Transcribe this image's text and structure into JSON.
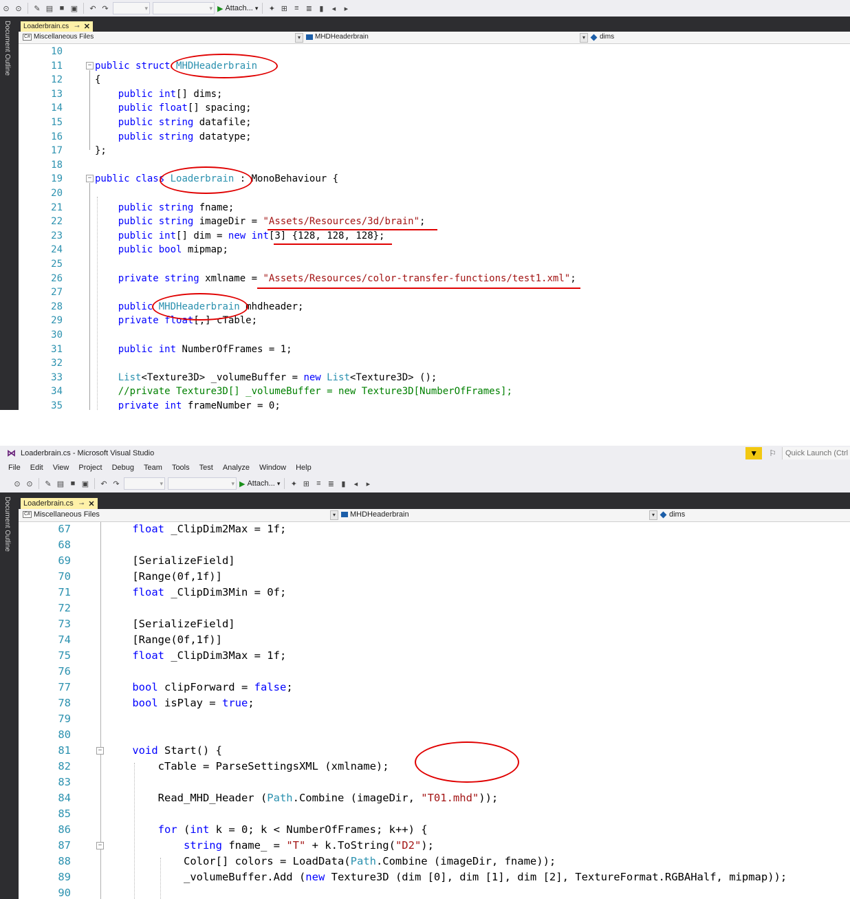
{
  "app_title": "Loaderbrain.cs - Microsoft Visual Studio",
  "quick_launch": "Quick Launch (Ctrl",
  "menu": [
    "File",
    "Edit",
    "View",
    "Project",
    "Debug",
    "Team",
    "Tools",
    "Test",
    "Analyze",
    "Window",
    "Help"
  ],
  "toolbar": {
    "attach_label": "Attach..."
  },
  "side_panel_label": "Document Outline",
  "tab": {
    "label": "Loaderbrain.cs",
    "pin": "⊸",
    "close": "✕"
  },
  "nav": {
    "project": "Miscellaneous Files",
    "type": "MHDHeaderbrain",
    "member": "dims"
  },
  "annotation_color": "#e00000",
  "colors": {
    "keyword": "#0000ff",
    "type": "#2b91af",
    "string": "#a31515",
    "comment": "#008000",
    "line_number": "#2b91af"
  },
  "shot1_lines": [
    {
      "n": "10",
      "tokens": []
    },
    {
      "n": "11",
      "tokens": [
        {
          "t": "public ",
          "c": "kw"
        },
        {
          "t": "struct ",
          "c": "kw"
        },
        {
          "t": "MHDHeaderbrain",
          "c": "ty"
        }
      ]
    },
    {
      "n": "12",
      "tokens": [
        {
          "t": "{"
        }
      ]
    },
    {
      "n": "13",
      "tokens": [
        {
          "t": "    "
        },
        {
          "t": "public ",
          "c": "kw"
        },
        {
          "t": "int",
          "c": "kw"
        },
        {
          "t": "[] dims;"
        }
      ]
    },
    {
      "n": "14",
      "tokens": [
        {
          "t": "    "
        },
        {
          "t": "public ",
          "c": "kw"
        },
        {
          "t": "float",
          "c": "kw"
        },
        {
          "t": "[] spacing;"
        }
      ]
    },
    {
      "n": "15",
      "tokens": [
        {
          "t": "    "
        },
        {
          "t": "public ",
          "c": "kw"
        },
        {
          "t": "string",
          "c": "kw"
        },
        {
          "t": " datafile;"
        }
      ]
    },
    {
      "n": "16",
      "tokens": [
        {
          "t": "    "
        },
        {
          "t": "public ",
          "c": "kw"
        },
        {
          "t": "string",
          "c": "kw"
        },
        {
          "t": " datatype;"
        }
      ]
    },
    {
      "n": "17",
      "tokens": [
        {
          "t": "};"
        }
      ]
    },
    {
      "n": "18",
      "tokens": []
    },
    {
      "n": "19",
      "tokens": [
        {
          "t": "public ",
          "c": "kw"
        },
        {
          "t": "class ",
          "c": "kw"
        },
        {
          "t": "Loaderbrain",
          "c": "ty"
        },
        {
          "t": " : MonoBehaviour {"
        }
      ]
    },
    {
      "n": "20",
      "tokens": []
    },
    {
      "n": "21",
      "tokens": [
        {
          "t": "    "
        },
        {
          "t": "public ",
          "c": "kw"
        },
        {
          "t": "string",
          "c": "kw"
        },
        {
          "t": " fname;"
        }
      ]
    },
    {
      "n": "22",
      "tokens": [
        {
          "t": "    "
        },
        {
          "t": "public ",
          "c": "kw"
        },
        {
          "t": "string",
          "c": "kw"
        },
        {
          "t": " imageDir = "
        },
        {
          "t": "\"Assets/Resources/3d/brain\"",
          "c": "str"
        },
        {
          "t": ";"
        }
      ]
    },
    {
      "n": "23",
      "tokens": [
        {
          "t": "    "
        },
        {
          "t": "public ",
          "c": "kw"
        },
        {
          "t": "int",
          "c": "kw"
        },
        {
          "t": "[] dim = "
        },
        {
          "t": "new ",
          "c": "kw"
        },
        {
          "t": "int",
          "c": "kw"
        },
        {
          "t": "[3] {128, 128, 128};"
        }
      ]
    },
    {
      "n": "24",
      "tokens": [
        {
          "t": "    "
        },
        {
          "t": "public ",
          "c": "kw"
        },
        {
          "t": "bool",
          "c": "kw"
        },
        {
          "t": " mipmap;"
        }
      ]
    },
    {
      "n": "25",
      "tokens": []
    },
    {
      "n": "26",
      "tokens": [
        {
          "t": "    "
        },
        {
          "t": "private ",
          "c": "kw"
        },
        {
          "t": "string",
          "c": "kw"
        },
        {
          "t": " xmlname = "
        },
        {
          "t": "\"Assets/Resources/color-transfer-functions/test1.xml\"",
          "c": "str"
        },
        {
          "t": ";"
        }
      ]
    },
    {
      "n": "27",
      "tokens": []
    },
    {
      "n": "28",
      "tokens": [
        {
          "t": "    "
        },
        {
          "t": "public ",
          "c": "kw"
        },
        {
          "t": "MHDHeaderbrain",
          "c": "ty"
        },
        {
          "t": " mhdheader;"
        }
      ]
    },
    {
      "n": "29",
      "tokens": [
        {
          "t": "    "
        },
        {
          "t": "private ",
          "c": "kw"
        },
        {
          "t": "float",
          "c": "kw"
        },
        {
          "t": "[,] cTable;"
        }
      ]
    },
    {
      "n": "30",
      "tokens": []
    },
    {
      "n": "31",
      "tokens": [
        {
          "t": "    "
        },
        {
          "t": "public ",
          "c": "kw"
        },
        {
          "t": "int",
          "c": "kw"
        },
        {
          "t": " NumberOfFrames = 1;"
        }
      ]
    },
    {
      "n": "32",
      "tokens": []
    },
    {
      "n": "33",
      "tokens": [
        {
          "t": "    "
        },
        {
          "t": "List",
          "c": "ty"
        },
        {
          "t": "<Texture3D> _volumeBuffer = "
        },
        {
          "t": "new ",
          "c": "kw"
        },
        {
          "t": "List",
          "c": "ty"
        },
        {
          "t": "<Texture3D> ();"
        }
      ]
    },
    {
      "n": "34",
      "tokens": [
        {
          "t": "    "
        },
        {
          "t": "//private Texture3D[] _volumeBuffer = new Texture3D[NumberOfFrames];",
          "c": "cm"
        }
      ]
    },
    {
      "n": "35",
      "tokens": [
        {
          "t": "    "
        },
        {
          "t": "private ",
          "c": "kw"
        },
        {
          "t": "int",
          "c": "kw"
        },
        {
          "t": " frameNumber = 0;"
        }
      ]
    }
  ],
  "shot2_lines": [
    {
      "n": "67",
      "tokens": [
        {
          "t": "    "
        },
        {
          "t": "float",
          "c": "kw"
        },
        {
          "t": " _ClipDim2Max = 1f;"
        }
      ]
    },
    {
      "n": "68",
      "tokens": []
    },
    {
      "n": "69",
      "tokens": [
        {
          "t": "    [SerializeField]"
        }
      ]
    },
    {
      "n": "70",
      "tokens": [
        {
          "t": "    [Range(0f,1f)]"
        }
      ]
    },
    {
      "n": "71",
      "tokens": [
        {
          "t": "    "
        },
        {
          "t": "float",
          "c": "kw"
        },
        {
          "t": " _ClipDim3Min = 0f;"
        }
      ]
    },
    {
      "n": "72",
      "tokens": []
    },
    {
      "n": "73",
      "tokens": [
        {
          "t": "    [SerializeField]"
        }
      ]
    },
    {
      "n": "74",
      "tokens": [
        {
          "t": "    [Range(0f,1f)]"
        }
      ]
    },
    {
      "n": "75",
      "tokens": [
        {
          "t": "    "
        },
        {
          "t": "float",
          "c": "kw"
        },
        {
          "t": " _ClipDim3Max = 1f;"
        }
      ]
    },
    {
      "n": "76",
      "tokens": []
    },
    {
      "n": "77",
      "tokens": [
        {
          "t": "    "
        },
        {
          "t": "bool",
          "c": "kw"
        },
        {
          "t": " clipForward = "
        },
        {
          "t": "false",
          "c": "kw"
        },
        {
          "t": ";"
        }
      ]
    },
    {
      "n": "78",
      "tokens": [
        {
          "t": "    "
        },
        {
          "t": "bool",
          "c": "kw"
        },
        {
          "t": " isPlay = "
        },
        {
          "t": "true",
          "c": "kw"
        },
        {
          "t": ";"
        }
      ]
    },
    {
      "n": "79",
      "tokens": []
    },
    {
      "n": "80",
      "tokens": []
    },
    {
      "n": "81",
      "tokens": [
        {
          "t": "    "
        },
        {
          "t": "void",
          "c": "kw"
        },
        {
          "t": " Start() {"
        }
      ]
    },
    {
      "n": "82",
      "tokens": [
        {
          "t": "        cTable = ParseSettingsXML (xmlname);"
        }
      ]
    },
    {
      "n": "83",
      "tokens": []
    },
    {
      "n": "84",
      "tokens": [
        {
          "t": "        Read_MHD_Header ("
        },
        {
          "t": "Path",
          "c": "ty"
        },
        {
          "t": ".Combine (imageDir, "
        },
        {
          "t": "\"T01.mhd\"",
          "c": "str"
        },
        {
          "t": "));"
        }
      ]
    },
    {
      "n": "85",
      "tokens": []
    },
    {
      "n": "86",
      "tokens": [
        {
          "t": "        "
        },
        {
          "t": "for",
          "c": "kw"
        },
        {
          "t": " ("
        },
        {
          "t": "int",
          "c": "kw"
        },
        {
          "t": " k = 0; k < NumberOfFrames; k++) {"
        }
      ]
    },
    {
      "n": "87",
      "tokens": [
        {
          "t": "            "
        },
        {
          "t": "string",
          "c": "kw"
        },
        {
          "t": " fname_ = "
        },
        {
          "t": "\"T\"",
          "c": "str"
        },
        {
          "t": " + k.ToString("
        },
        {
          "t": "\"D2\"",
          "c": "str"
        },
        {
          "t": ");"
        }
      ]
    },
    {
      "n": "88",
      "tokens": [
        {
          "t": "            Color[] colors = LoadData("
        },
        {
          "t": "Path",
          "c": "ty"
        },
        {
          "t": ".Combine (imageDir, fname));"
        }
      ]
    },
    {
      "n": "89",
      "tokens": [
        {
          "t": "            _volumeBuffer.Add ("
        },
        {
          "t": "new",
          "c": "kw"
        },
        {
          "t": " Texture3D (dim [0], dim [1], dim [2], TextureFormat.RGBAHalf, mipmap));"
        }
      ]
    },
    {
      "n": "90",
      "tokens": []
    }
  ]
}
